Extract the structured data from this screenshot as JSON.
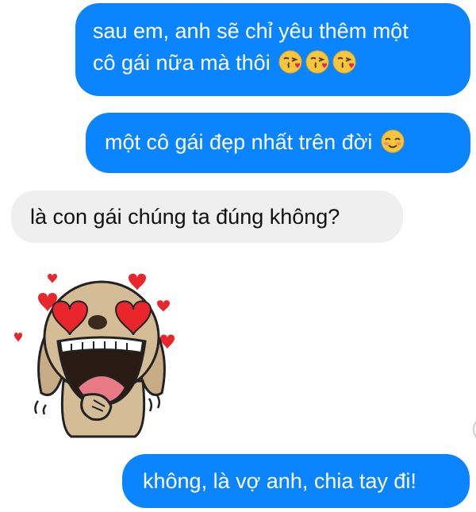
{
  "messages": [
    {
      "side": "out",
      "lines": [
        "sau em, anh sẽ chỉ yêu thêm một",
        "cô gái nữa mà thôi"
      ],
      "emojis": [
        "kiss-heart-emoji",
        "kiss-heart-emoji",
        "kiss-heart-emoji"
      ]
    },
    {
      "side": "out",
      "lines": [
        "một cô gái đẹp nhất trên đời"
      ],
      "emojis": [
        "blushing-smile-emoji"
      ]
    },
    {
      "side": "in",
      "lines": [
        "là con gái chúng ta đúng không?"
      ]
    },
    {
      "side": "in",
      "sticker": "heart-eyes-puppy-sticker"
    },
    {
      "side": "out",
      "lines": [
        "không, là vợ anh, chia tay đi!"
      ]
    }
  ],
  "colors": {
    "outgoing_bubble": "#0a84ff",
    "incoming_bubble": "#efefef",
    "outgoing_text": "#ffffff",
    "incoming_text": "#111111"
  }
}
